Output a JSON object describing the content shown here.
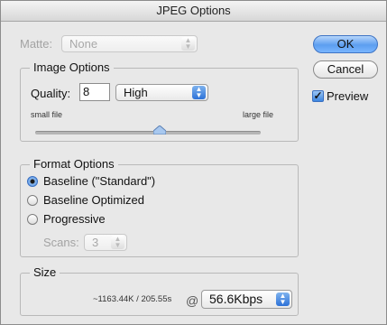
{
  "window": {
    "title": "JPEG Options"
  },
  "matte": {
    "label": "Matte:",
    "value": "None"
  },
  "image_options": {
    "title": "Image Options",
    "quality_label": "Quality:",
    "quality_value": "8",
    "quality_preset": "High",
    "small_file_label": "small file",
    "large_file_label": "large file",
    "slider_level": 0.55
  },
  "format_options": {
    "title": "Format Options",
    "options": [
      {
        "label": "Baseline (\"Standard\")",
        "selected": true
      },
      {
        "label": "Baseline Optimized",
        "selected": false
      },
      {
        "label": "Progressive",
        "selected": false
      }
    ],
    "scans_label": "Scans:",
    "scans_value": "3"
  },
  "size": {
    "title": "Size",
    "estimate": "~1163.44K / 205.55s",
    "at_symbol": "@",
    "speed": "56.6Kbps"
  },
  "buttons": {
    "ok": "OK",
    "cancel": "Cancel"
  },
  "preview": {
    "label": "Preview",
    "checked": true
  },
  "colors": {
    "accent": "#4c8ee5",
    "disabled_text": "#a3a3a3"
  }
}
